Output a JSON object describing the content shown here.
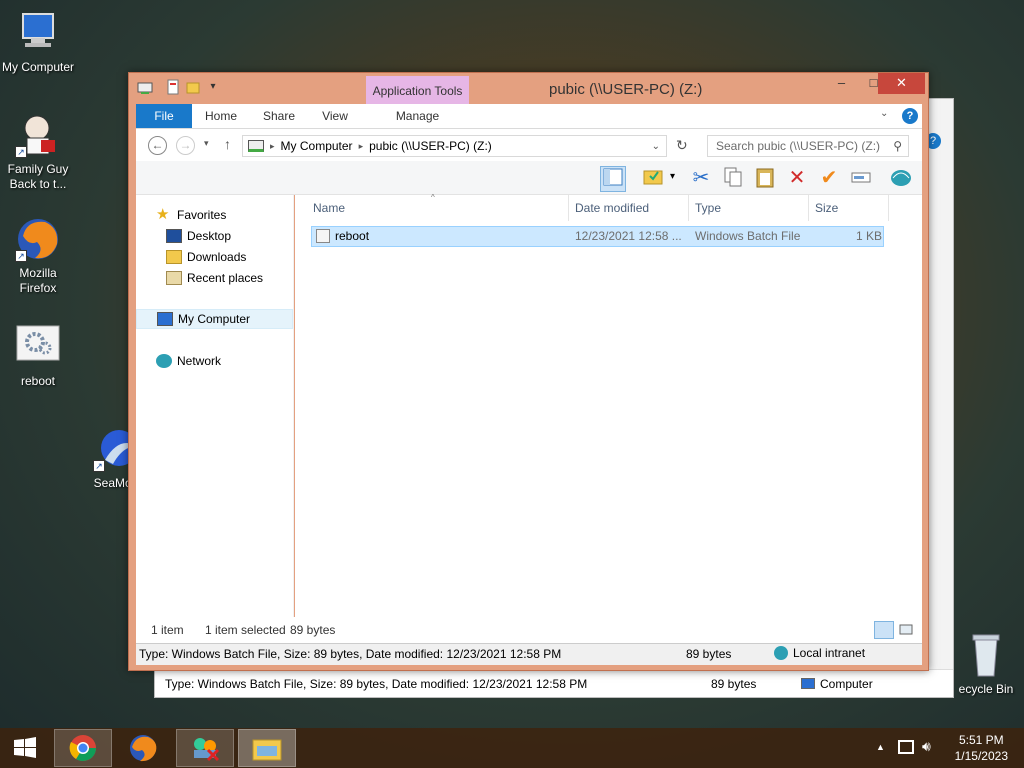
{
  "desktop": {
    "icons": [
      {
        "label": "My Computer",
        "icon": "computer-icon"
      },
      {
        "label": "Family Guy Back to t...",
        "icon": "family-guy-icon"
      },
      {
        "label": "Mozilla Firefox",
        "icon": "firefox-icon"
      },
      {
        "label": "reboot",
        "icon": "batch-file-icon"
      },
      {
        "label": "SeaMon",
        "icon": "seamonkey-icon"
      },
      {
        "label": "ecycle Bin",
        "icon": "recycle-bin-icon"
      }
    ]
  },
  "back_window": {
    "status_text": "Type: Windows Batch File, Size: 89 bytes, Date modified: 12/23/2021 12:58 PM",
    "status_size": "89 bytes",
    "status_zone": "Computer"
  },
  "window": {
    "title": "pubic (\\\\USER-PC) (Z:)",
    "app_tools_label": "Application Tools",
    "min_glyph": "‒",
    "max_glyph": "□",
    "close_glyph": "✕",
    "tabs": [
      "File",
      "Home",
      "Share",
      "View",
      "Manage"
    ],
    "address": {
      "crumbs": [
        "My Computer",
        "pubic (\\\\USER-PC) (Z:)"
      ]
    },
    "search_placeholder": "Search pubic (\\\\USER-PC) (Z:)",
    "nav": {
      "favorites": "Favorites",
      "items": [
        "Desktop",
        "Downloads",
        "Recent places"
      ],
      "computer": "My Computer",
      "network": "Network"
    },
    "columns": [
      "Name",
      "Date modified",
      "Type",
      "Size"
    ],
    "files": [
      {
        "name": "reboot",
        "date": "12/23/2021 12:58 ...",
        "type": "Windows Batch File",
        "size": "1 KB"
      }
    ],
    "status": {
      "count": "1 item",
      "selected": "1 item selected",
      "selected_size": "89 bytes"
    },
    "details": {
      "text": "Type: Windows Batch File, Size: 89 bytes, Date modified: 12/23/2021 12:58 PM",
      "size": "89 bytes",
      "zone": "Local intranet"
    }
  },
  "taskbar": {
    "apps": [
      "start-icon",
      "chrome-icon",
      "firefox-icon",
      "network-tool-icon",
      "file-explorer-icon"
    ],
    "time": "5:51 PM",
    "date": "1/15/2023"
  }
}
